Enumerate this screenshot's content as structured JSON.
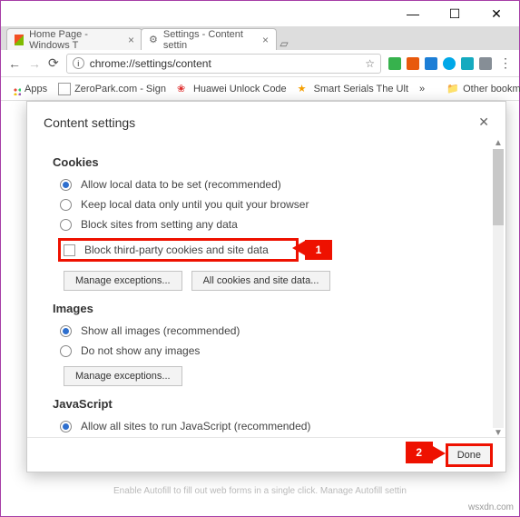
{
  "window": {
    "controls": {
      "min": "—",
      "max": "☐",
      "close": "✕"
    }
  },
  "tabs": [
    {
      "title": "Home Page - Windows T",
      "active": false
    },
    {
      "title": "Settings - Content settin",
      "active": true
    }
  ],
  "address": {
    "url": "chrome://settings/content",
    "star": "☆"
  },
  "extensions": [
    {
      "name": "ext-1",
      "color": "#37b24d"
    },
    {
      "name": "ext-2",
      "color": "#e8590c"
    },
    {
      "name": "ext-3",
      "color": "#1c7ed6"
    },
    {
      "name": "ext-4",
      "color": "#00a8e8"
    },
    {
      "name": "ext-5",
      "color": "#15aabf"
    },
    {
      "name": "ext-6",
      "color": "#868e96"
    }
  ],
  "menu_dots": "⋮",
  "bookmarks": {
    "apps": "Apps",
    "items": [
      {
        "label": "ZeroPark.com - Sign"
      },
      {
        "label": "Huawei Unlock Code"
      },
      {
        "label": "Smart Serials The Ult"
      }
    ],
    "overflow": "»",
    "other": "Other bookmarks"
  },
  "modal": {
    "title": "Content settings",
    "close": "✕",
    "sections": {
      "cookies": {
        "title": "Cookies",
        "options": [
          "Allow local data to be set (recommended)",
          "Keep local data only until you quit your browser",
          "Block sites from setting any data"
        ],
        "checkbox": "Block third-party cookies and site data",
        "btn_manage": "Manage exceptions...",
        "btn_all": "All cookies and site data..."
      },
      "images": {
        "title": "Images",
        "options": [
          "Show all images (recommended)",
          "Do not show any images"
        ],
        "btn_manage": "Manage exceptions..."
      },
      "javascript": {
        "title": "JavaScript",
        "options": [
          "Allow all sites to run JavaScript (recommended)"
        ]
      }
    },
    "done": "Done"
  },
  "callouts": {
    "one": "1",
    "two": "2"
  },
  "behind_text": "Enable Autofill to fill out web forms in a single click. Manage Autofill settin",
  "watermark": "wsxdn.com"
}
